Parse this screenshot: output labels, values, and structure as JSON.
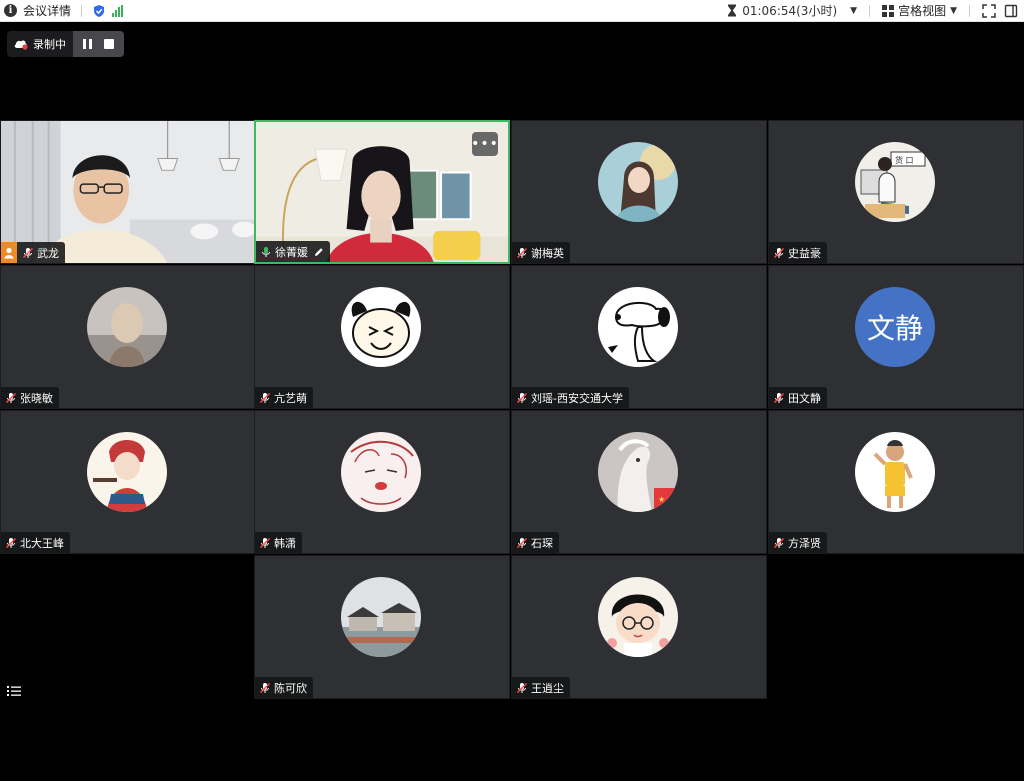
{
  "topbar": {
    "meeting_details": "会议详情",
    "timer": "01:06:54(3小时)",
    "view_mode": "宫格视图"
  },
  "recording": {
    "label": "录制中"
  },
  "colors": {
    "speaking_border": "#3dba5f",
    "host_badge": "#f08a24",
    "tile_bg": "#2f3034",
    "avatar_text_bg": "#4472c4"
  },
  "participants": [
    {
      "name": "武龙",
      "host": true,
      "video": true
    },
    {
      "name": "徐菁媛",
      "speaking": true,
      "video": true
    },
    {
      "name": "谢梅英"
    },
    {
      "name": "史益豪"
    },
    {
      "name": "张晓敏"
    },
    {
      "name": "亢艺萌"
    },
    {
      "name": "刘瑶-西安交通大学"
    },
    {
      "name": "田文静",
      "avatar_text": "文静"
    },
    {
      "name": "北大王峰"
    },
    {
      "name": "韩潇"
    },
    {
      "name": "石琛"
    },
    {
      "name": "方泽贤"
    },
    {
      "name": "陈可欣"
    },
    {
      "name": "王逍尘"
    }
  ]
}
